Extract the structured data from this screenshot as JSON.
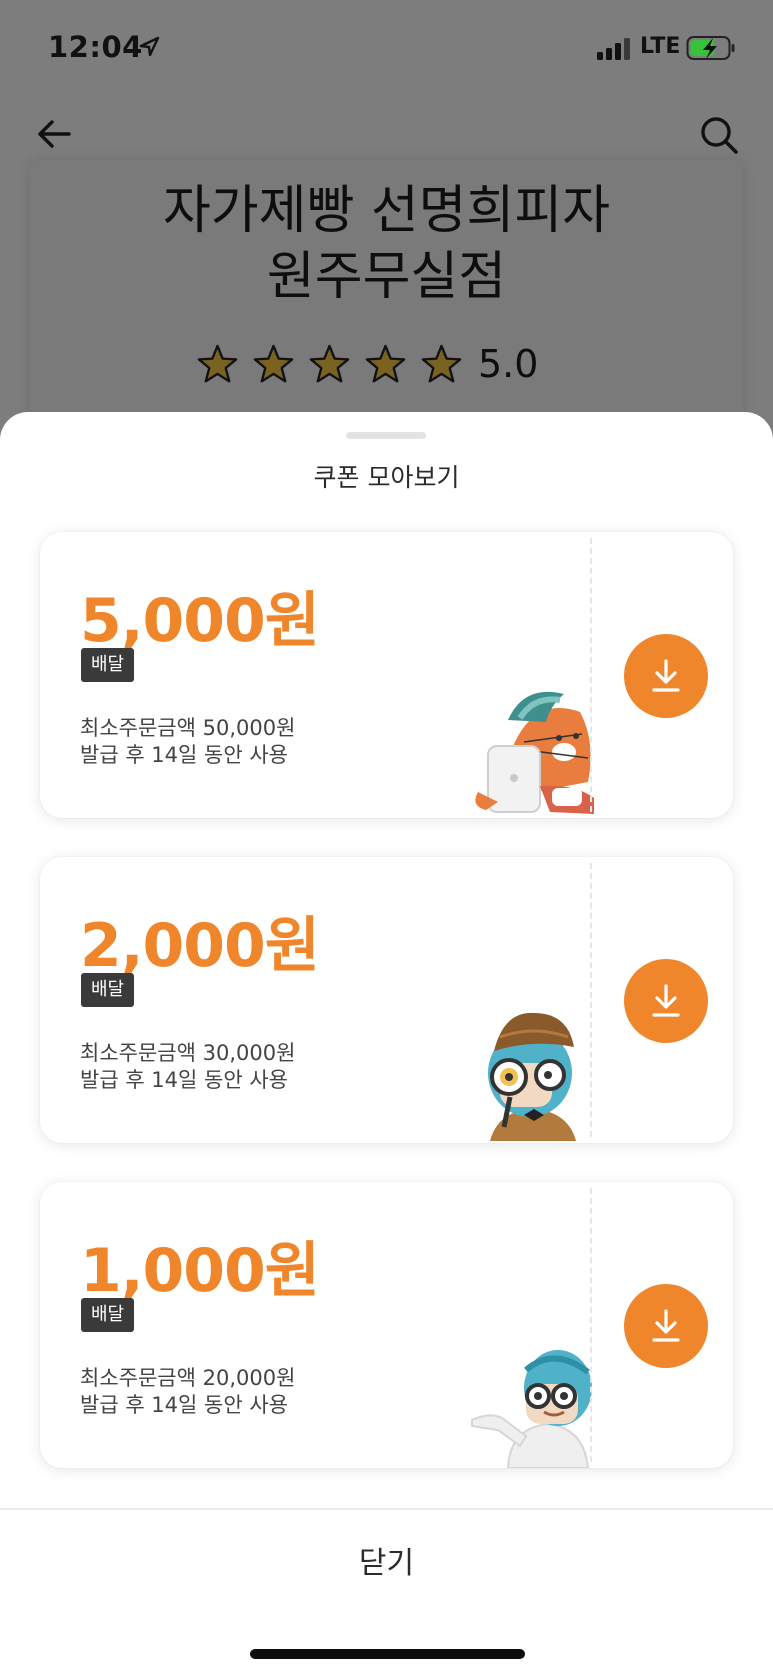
{
  "status_bar": {
    "time": "12:04",
    "network": "LTE"
  },
  "store": {
    "name_line1": "자가제빵 선명희피자",
    "name_line2": "원주무실점",
    "rating": "5.0",
    "stars": 5
  },
  "sheet": {
    "title": "쿠폰 모아보기",
    "close_label": "닫기"
  },
  "coupons": [
    {
      "amount": "5,000원",
      "tag": "배달",
      "min_order": "최소주문금액 50,000원",
      "period": "발급 후 14일 동안 사용",
      "illustration": "cat-tablet-illustration"
    },
    {
      "amount": "2,000원",
      "tag": "배달",
      "min_order": "최소주문금액 30,000원",
      "period": "발급 후 14일 동안 사용",
      "illustration": "detective-magnifier-illustration"
    },
    {
      "amount": "1,000원",
      "tag": "배달",
      "min_order": "최소주문금액 20,000원",
      "period": "발급 후 14일 동안 사용",
      "illustration": "character-pointing-illustration"
    }
  ],
  "colors": {
    "accent": "#f0862c",
    "tag_bg": "#3a3a3a",
    "overlay": "#7d7d7d"
  }
}
